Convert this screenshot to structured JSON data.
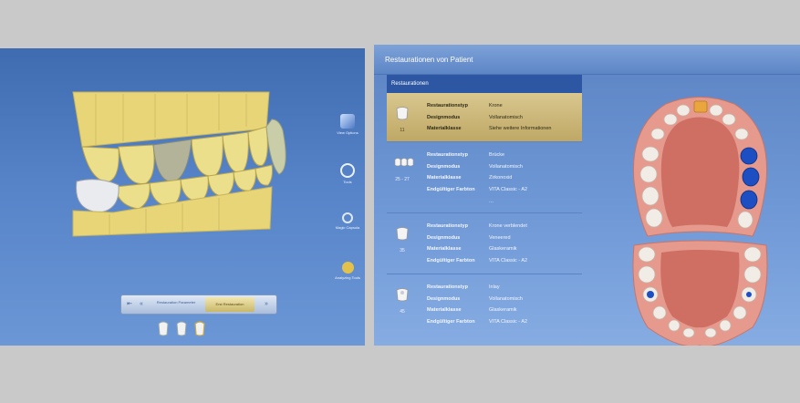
{
  "right_panel": {
    "title": "Restaurationen von Patient",
    "list_header": "Restaurationen",
    "entries": [
      {
        "tooth": "11",
        "rows": [
          {
            "key": "Restaurationstyp",
            "value": "Krone"
          },
          {
            "key": "Designmodus",
            "value": "Vollanatomisch"
          },
          {
            "key": "Materialklasse",
            "value": "Siehe weitere Informationen"
          }
        ]
      },
      {
        "tooth": "25 - 27",
        "rows": [
          {
            "key": "Restaurationstyp",
            "value": "Brücke"
          },
          {
            "key": "Designmodus",
            "value": "Vollanatomisch"
          },
          {
            "key": "Materialklasse",
            "value": "Zirkonoxid"
          },
          {
            "key": "Endgültiger Farbton",
            "value": "VITA Classic - A2"
          }
        ],
        "more": "..."
      },
      {
        "tooth": "35",
        "rows": [
          {
            "key": "Restaurationstyp",
            "value": "Krone verblendet"
          },
          {
            "key": "Designmodus",
            "value": "Veneered"
          },
          {
            "key": "Materialklasse",
            "value": "Glaskeramik"
          },
          {
            "key": "Endgültiger Farbton",
            "value": "VITA Classic - A2"
          }
        ]
      },
      {
        "tooth": "45",
        "rows": [
          {
            "key": "Restaurationstyp",
            "value": "Inlay"
          },
          {
            "key": "Designmodus",
            "value": "Vollanatomisch"
          },
          {
            "key": "Materialklasse",
            "value": "Glaskeramik"
          },
          {
            "key": "Endgültiger Farbton",
            "value": "VITA Classic - A2"
          }
        ]
      }
    ]
  },
  "left_panel": {
    "tools": [
      {
        "label": "View Options",
        "icon": "view-options-icon"
      },
      {
        "label": "Tools",
        "icon": "tools-icon"
      },
      {
        "label": "Magic Capsula",
        "icon": "magnifier-icon"
      },
      {
        "label": "Analyzing Tools",
        "icon": "analyzing-tools-icon"
      }
    ],
    "steps": {
      "prev": "Restauration Parameter",
      "current": "Erst Restauration"
    }
  },
  "colors": {
    "selected_row": "#cdb878",
    "panel_blue": "#5a86c8",
    "model_yellow": "#e8d77c",
    "gingiva": "#e39387",
    "restoration_blue": "#1d4fc2"
  }
}
